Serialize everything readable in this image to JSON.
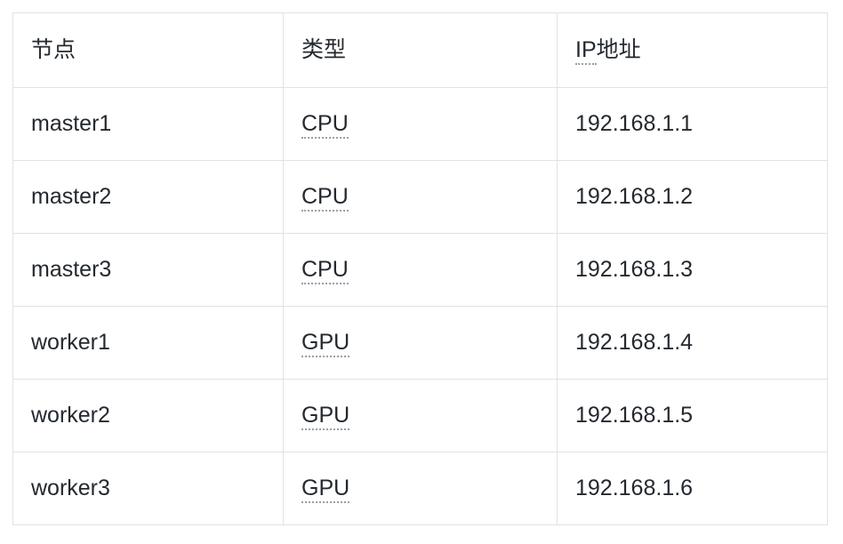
{
  "table": {
    "columns": [
      {
        "key": "node",
        "label": "节点",
        "abbr": false
      },
      {
        "key": "type",
        "label": "类型",
        "abbr": false
      },
      {
        "key": "ip",
        "label_abbr": "IP",
        "label_rest": "地址",
        "abbr": true
      }
    ],
    "rows": [
      {
        "node": "master1",
        "type": "CPU",
        "ip": "192.168.1.1"
      },
      {
        "node": "master2",
        "type": "CPU",
        "ip": "192.168.1.2"
      },
      {
        "node": "master3",
        "type": "CPU",
        "ip": "192.168.1.3"
      },
      {
        "node": "worker1",
        "type": "GPU",
        "ip": "192.168.1.4"
      },
      {
        "node": "worker2",
        "type": "GPU",
        "ip": "192.168.1.5"
      },
      {
        "node": "worker3",
        "type": "GPU",
        "ip": "192.168.1.6"
      }
    ]
  },
  "style": {
    "border_color": "#dfe2e5",
    "text_color": "#24292f",
    "background": "#ffffff",
    "abbr_underline_color": "#9aa0a6"
  }
}
